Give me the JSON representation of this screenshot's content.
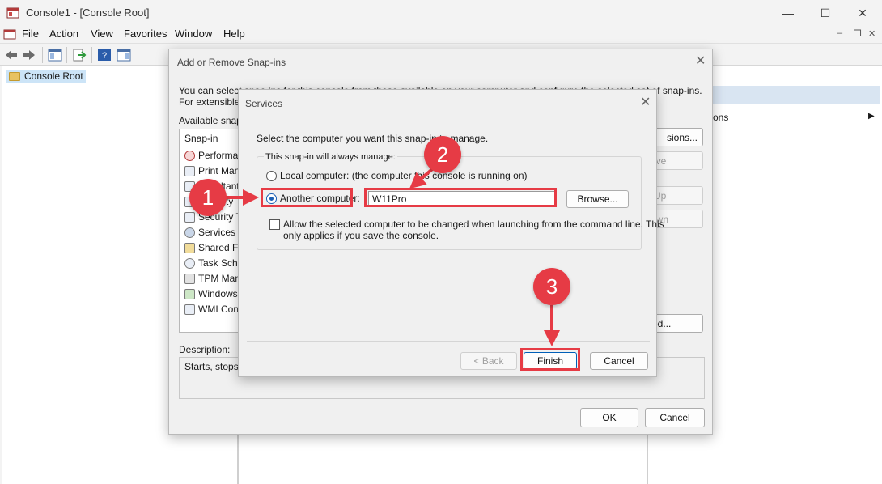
{
  "window": {
    "title": "Console1 - [Console Root]",
    "controls": {
      "minimize": "—",
      "maximize": "☐",
      "close": "✕"
    },
    "inner_controls": {
      "minimize": "–",
      "restore": "❐",
      "close": "✕"
    }
  },
  "menu": [
    "File",
    "Action",
    "View",
    "Favorites",
    "Window",
    "Help"
  ],
  "tree": {
    "root": "Console Root"
  },
  "actions_pane": {
    "partial_item": "ons",
    "arrow": "▶"
  },
  "snapin_dialog": {
    "title": "Add or Remove Snap-ins",
    "close": "✕",
    "intro_line1": "You can select snap-ins for this console from those available on your computer and configure the selected set of snap-ins.",
    "intro_line2": "For extensible",
    "available_label": "Available snap",
    "column_header": "Snap-in",
    "items": [
      "Performan",
      "Print Man",
      "Resultant",
      "Security",
      "Security T",
      "Services",
      "Shared Fo",
      "Task Sche",
      "TPM Man",
      "Windows",
      "WMI Con"
    ],
    "description_label": "Description:",
    "description_text": "Starts, stops,",
    "right_buttons": {
      "extensions": "sions...",
      "remove": "ove",
      "move_up": "Up",
      "move_down": "own",
      "advanced": "ed..."
    },
    "ok": "OK",
    "cancel": "Cancel"
  },
  "services_dialog": {
    "title": "Services",
    "close": "✕",
    "prompt": "Select the computer you want this snap-in to manage.",
    "group_label": "This snap-in will always manage:",
    "local_option": "Local computer:  (the computer this console is running on)",
    "another_option": "Another computer:",
    "computer_name": "W11Pro",
    "browse": "Browse...",
    "allow_change_line1": "Allow the selected computer to be changed when launching from the command line.  This",
    "allow_change_line2": "only applies if you save the console.",
    "back": "< Back",
    "finish": "Finish",
    "cancel": "Cancel"
  },
  "annotations": {
    "step1": "1",
    "step2": "2",
    "step3": "3",
    "color": "#e63b45"
  }
}
